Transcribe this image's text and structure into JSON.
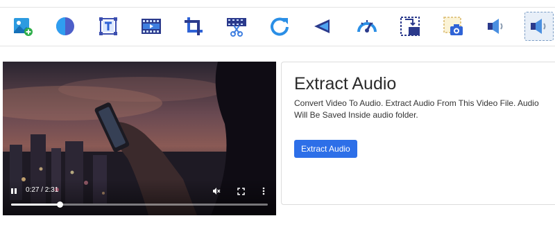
{
  "toolbar": {
    "tools": [
      {
        "icon": "add-image-icon"
      },
      {
        "icon": "color-filter-icon"
      },
      {
        "icon": "text-overlay-icon"
      },
      {
        "icon": "film-icon"
      },
      {
        "icon": "crop-icon"
      },
      {
        "icon": "cut-video-icon"
      },
      {
        "icon": "rotate-icon"
      },
      {
        "icon": "rewind-icon"
      },
      {
        "icon": "speed-icon"
      },
      {
        "icon": "resize-icon"
      },
      {
        "icon": "screenshot-icon"
      },
      {
        "icon": "volume-icon"
      },
      {
        "icon": "extract-audio-icon",
        "active": true
      }
    ]
  },
  "player": {
    "time_display": "0:27 / 2:31",
    "progress": 0.19,
    "muted": true
  },
  "card": {
    "title": "Extract Audio",
    "description": "Convert Video To Audio. Extract Audio From This Video File. Audio Will Be Saved Inside audio folder.",
    "button_label": "Extract Audio"
  },
  "colors": {
    "accent": "#2d6fe8",
    "icon_blue": "#1f8fd8",
    "icon_navy": "#2b3a8c"
  }
}
